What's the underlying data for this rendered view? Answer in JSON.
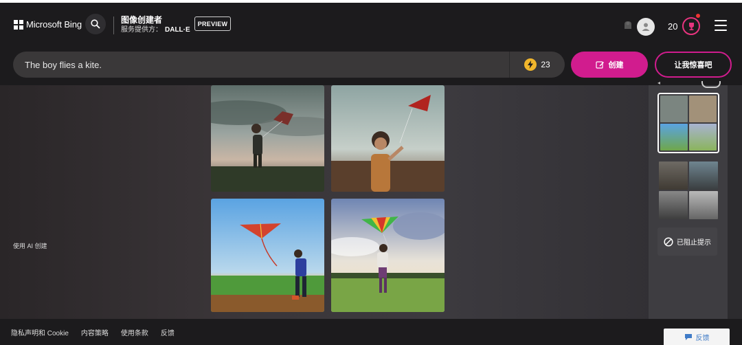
{
  "header": {
    "brand": "Microsoft Bing",
    "app_title": "图像创建者",
    "provider_label": "服务提供方：",
    "provider_name": "DALL·E",
    "badge": "PREVIEW",
    "points": "20",
    "icons": [
      "windows-logo-icon",
      "search-icon",
      "rewards-icon",
      "avatar-icon",
      "trophy-icon",
      "hamburger-menu-icon"
    ]
  },
  "prompt": {
    "value": "The boy flies a kite.",
    "boosts": "23"
  },
  "buttons": {
    "create": "创建",
    "surprise": "让我惊喜吧"
  },
  "main": {
    "powered_by": "使用 AI 创建",
    "images": [
      {
        "description": "boy with kite, cloudy dusk sky"
      },
      {
        "description": "boy holding red kite string"
      },
      {
        "description": "boy flying red kite, blue sky"
      },
      {
        "description": "boy flying rainbow kite, field"
      }
    ]
  },
  "sidebar": {
    "blocked_label": "已阻止提示"
  },
  "footer": {
    "links": [
      "隐私声明和 Cookie",
      "内容策略",
      "使用条款",
      "反馈"
    ],
    "feedback_button": "反馈"
  }
}
